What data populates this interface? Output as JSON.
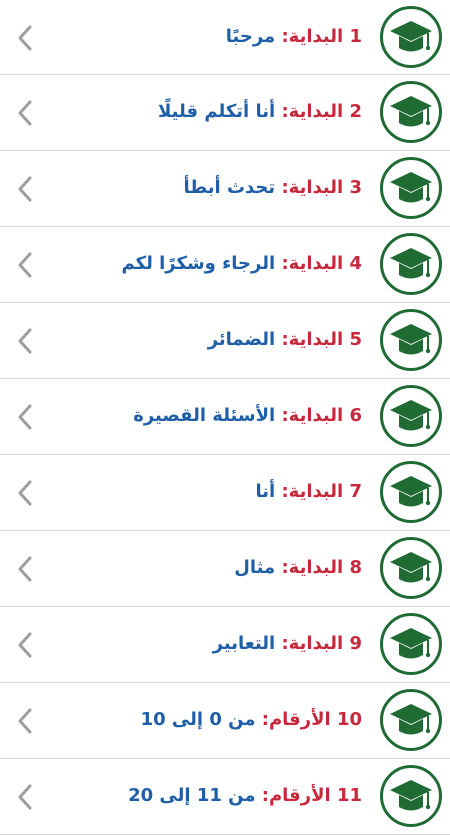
{
  "lessons": [
    {
      "num": "1",
      "category": "البداية",
      "separator": ":",
      "subtitle": "مرحبًا"
    },
    {
      "num": "2",
      "category": "البداية",
      "separator": ":",
      "subtitle": "أنا أتكلم قليلًا"
    },
    {
      "num": "3",
      "category": "البداية",
      "separator": ":",
      "subtitle": "تحدث أبطأ"
    },
    {
      "num": "4",
      "category": "البداية",
      "separator": ":",
      "subtitle": "الرجاء وشكرًا لكم"
    },
    {
      "num": "5",
      "category": "البداية",
      "separator": ":",
      "subtitle": "الضمائر"
    },
    {
      "num": "6",
      "category": "البداية",
      "separator": ":",
      "subtitle": "الأسئلة القصيرة"
    },
    {
      "num": "7",
      "category": "البداية",
      "separator": ":",
      "subtitle": "أنا"
    },
    {
      "num": "8",
      "category": "البداية",
      "separator": ":",
      "subtitle": "مثال"
    },
    {
      "num": "9",
      "category": "البداية",
      "separator": ":",
      "subtitle": "التعابير"
    },
    {
      "num": "10",
      "category": "الأرقام",
      "separator": ":",
      "subtitle": "من 0 إلى 10"
    },
    {
      "num": "11",
      "category": "الأرقام",
      "separator": ":",
      "subtitle": "من 11 إلى 20"
    }
  ],
  "icons": {
    "avatar": "graduation-cap-icon",
    "chevron": "chevron-left-icon"
  },
  "colors": {
    "primary_green": "#1f6b33",
    "title_red": "#c8283c",
    "subtitle_blue": "#1f5fa8",
    "chevron_gray": "#9e9e9e",
    "divider": "#d6d6d6"
  }
}
